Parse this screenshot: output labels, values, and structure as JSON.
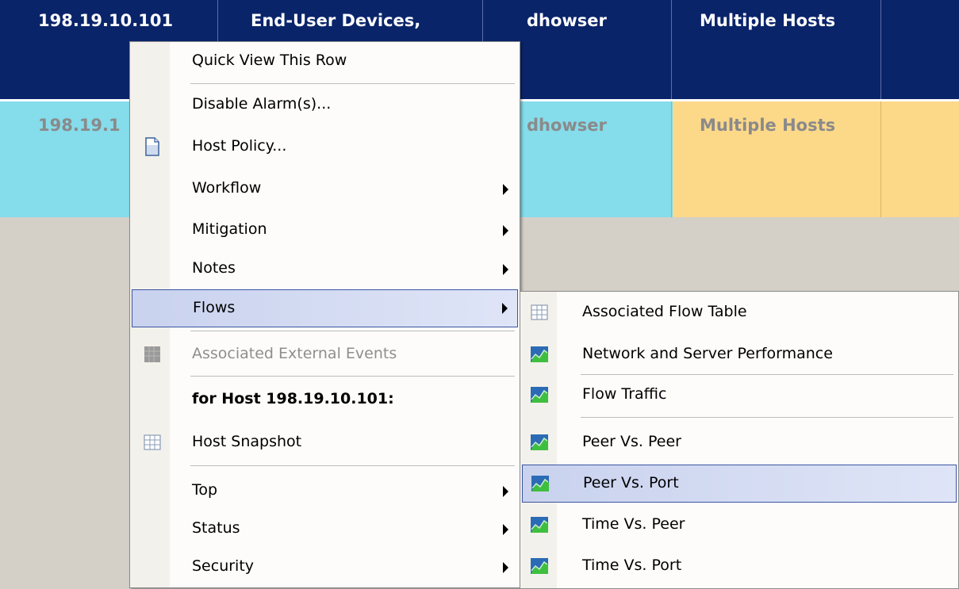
{
  "table": {
    "row1": {
      "ip": "198.19.10.101",
      "category": "End-User Devices,",
      "user": "dhowser",
      "hosts": "Multiple Hosts"
    },
    "row2": {
      "ip": "198.19.1",
      "user": "dhowser",
      "hosts": "Multiple Hosts"
    }
  },
  "menu": {
    "quick_view": "Quick View This Row",
    "disable_alarms": "Disable Alarm(s)...",
    "host_policy": "Host Policy...",
    "workflow": "Workflow",
    "mitigation": "Mitigation",
    "notes": "Notes",
    "flows": "Flows",
    "assoc_external": "Associated External Events",
    "for_host": "for Host 198.19.10.101:",
    "host_snapshot": "Host Snapshot",
    "top": "Top",
    "status": "Status",
    "security": "Security"
  },
  "submenu": {
    "assoc_flow_table": "Associated Flow Table",
    "network_server_perf": "Network and Server Performance",
    "flow_traffic": "Flow Traffic",
    "peer_vs_peer": "Peer Vs. Peer",
    "peer_vs_port": "Peer Vs. Port",
    "time_vs_peer": "Time Vs. Peer",
    "time_vs_port": "Time Vs. Port"
  },
  "icons": {
    "document": "document-icon",
    "table": "table-grid-icon",
    "chart": "chart-icon",
    "external": "external-events-icon"
  },
  "colors": {
    "selected_row": "#0a246a",
    "row_cyan": "#85dceb",
    "row_orange": "#fcd889",
    "menu_highlight": "#c9d2ee"
  }
}
